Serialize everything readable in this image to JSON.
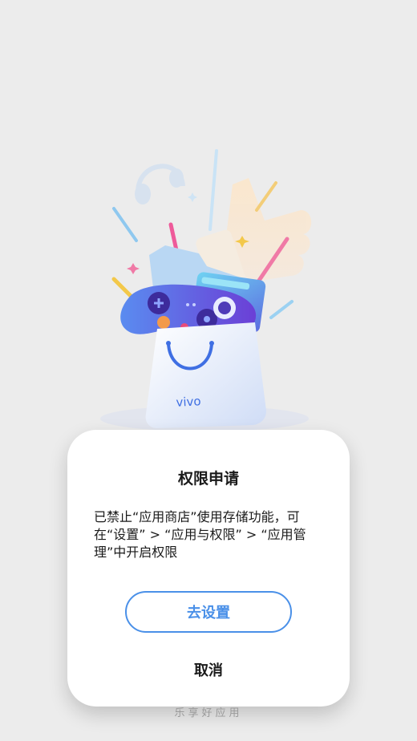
{
  "illustration": {
    "bag_brand": "vivo"
  },
  "dialog": {
    "title": "权限申请",
    "message": "已禁止“应用商店”使用存储功能，可在“设置” > “应用与权限” > “应用管理”中开启权限",
    "primary_button": "去设置",
    "cancel_button": "取消",
    "accent_color": "#4a90e8"
  },
  "footer": {
    "slogan": "乐享好应用"
  }
}
